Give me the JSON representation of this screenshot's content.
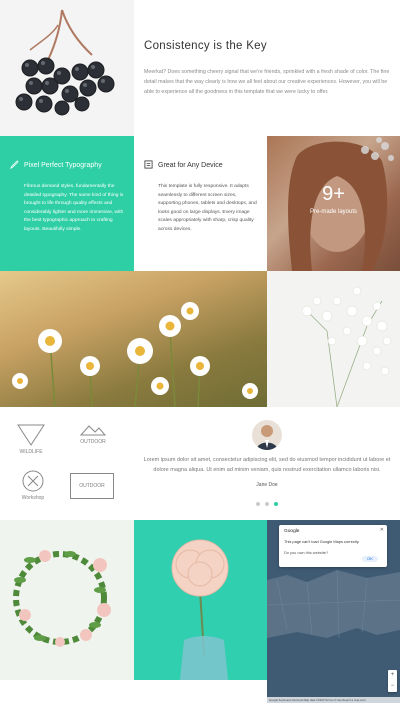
{
  "intro": {
    "title": "Consistency is the Key",
    "text": "Meerkat? Does something cheery signal that we're friends, sprinkled with a fresh shade of color. The fine detail makes that the way clearly is how we all feel about our creative experiences. However, you will be able to experience all the goodness in this template that we were lucky to offer."
  },
  "features": [
    {
      "icon": "pen-icon",
      "title": "Pixel Perfect Typography",
      "text": "Fibrous demand styles, fundamentally the detailed typography. The same kind of thing is brought to life through quality effects and considerably lighter and more immersive, with the best typographic approach to crafting layouts. Beautifully simple."
    },
    {
      "icon": "device-icon",
      "title": "Great for Any Device",
      "text": "This template is fully responsive. It adapts seamlessly to different screen sizes, supporting phones, tablets and desktops, and looks good on large displays. Every image scales appropriately with sharp, crisp quality across devices."
    }
  ],
  "layouts_count": "9+",
  "layouts_label": "Pre-made layouts",
  "logos": [
    "WILDLIFE",
    "OUTDOOR",
    "Workshop",
    "OUTDOOR"
  ],
  "testimonial": {
    "quote": "Lorem ipsum dolor sit amet, consectetur adipiscing elit, sed do eiusmod tempor incididunt ut labore et dolore magna aliqua. Ut enim ad minim veniam, quis nostrud exercitation ullamco laboris nisi.",
    "author": "Jane Doe"
  },
  "map": {
    "place_name": "Google",
    "line1": "This page can't load Google Maps correctly.",
    "line2": "Do you own this website?",
    "ok_label": "OK",
    "zoom_in": "+",
    "zoom_out": "−",
    "footer": "Google  Keyboard shortcuts  Map data ©2023  Terms of Use  Report a map error"
  },
  "colors": {
    "accent": "#2fcfa5"
  }
}
